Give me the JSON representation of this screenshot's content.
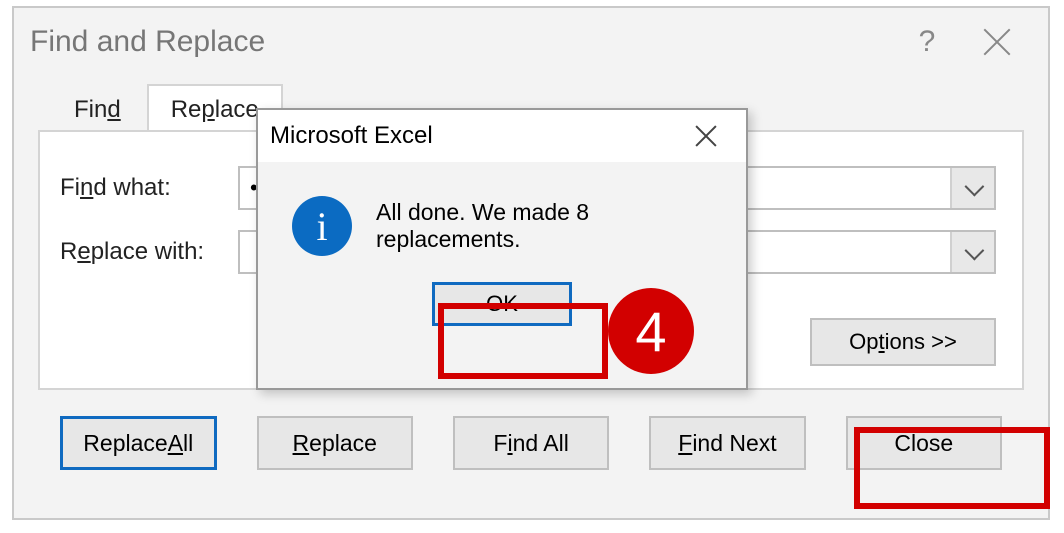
{
  "dialog": {
    "title": "Find and Replace",
    "help_symbol": "?",
    "tabs": {
      "find": "Find",
      "replace": "Replace",
      "active": "replace"
    },
    "find_label_pre": "Fi",
    "find_label_ul": "n",
    "find_label_post": "d what:",
    "find_value": "•",
    "replace_label_pre": "R",
    "replace_label_ul": "e",
    "replace_label_post": "place with:",
    "replace_value": "",
    "options_pre": "Op",
    "options_ul": "t",
    "options_post": "ions >>",
    "buttons": {
      "replace_all_pre": "Replace ",
      "replace_all_ul": "A",
      "replace_all_post": "ll",
      "replace_ul": "R",
      "replace_post": "eplace",
      "find_all_pre": "F",
      "find_all_ul": "i",
      "find_all_post": "nd All",
      "find_next_ul": "F",
      "find_next_post": "ind Next",
      "close": "Close"
    }
  },
  "msg": {
    "title": "Microsoft Excel",
    "text": "All done. We made 8 replacements.",
    "ok": "OK",
    "info_glyph": "i"
  },
  "annotation": {
    "step": "4"
  }
}
